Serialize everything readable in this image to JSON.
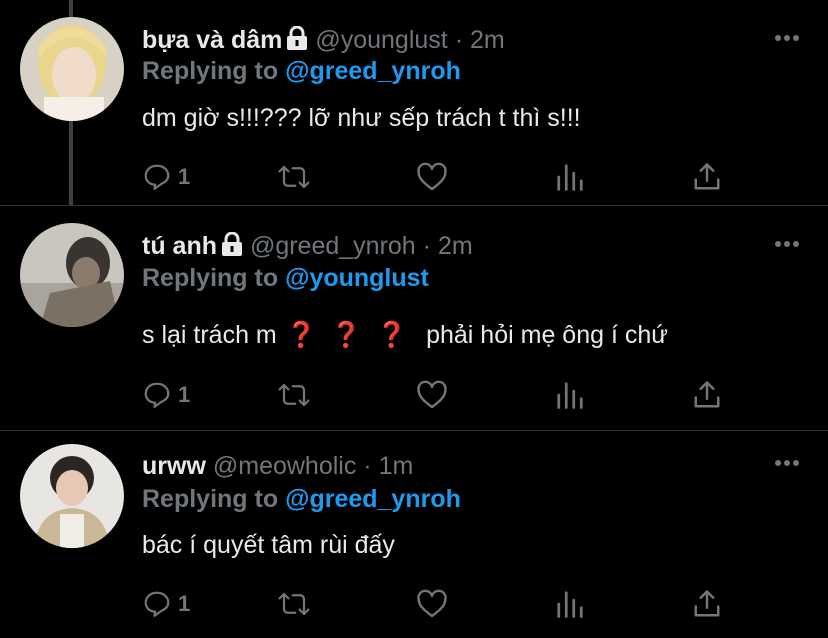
{
  "colors": {
    "background": "#000000",
    "accent": "#1d9bf0",
    "muted": "#71767b",
    "text": "#e7e9ea",
    "question_mark": "#e0245e"
  },
  "tweets": [
    {
      "name": "bựa và dâm",
      "protected": true,
      "handle": "@younglust",
      "separator": "·",
      "time": "2m",
      "replying_prefix": "Replying to",
      "replying_to": "@greed_ynroh",
      "text": "dm giờ s!!!??? lỡ như sếp trách t thì s!!!",
      "reply_count": "1",
      "icons": [
        "reply-icon",
        "retweet-icon",
        "like-icon",
        "analytics-icon",
        "share-icon",
        "more-icon",
        "lock-icon"
      ]
    },
    {
      "name": "tú anh",
      "protected": true,
      "handle": "@greed_ynroh",
      "separator": "·",
      "time": "2m",
      "replying_prefix": "Replying to",
      "replying_to": "@younglust",
      "text_before": "s lại trách m",
      "emoji": [
        "❓",
        "❓",
        "❓"
      ],
      "text_after": "phải hỏi mẹ ông í chứ",
      "reply_count": "1"
    },
    {
      "name": "urww",
      "protected": false,
      "handle": "@meowholic",
      "separator": "·",
      "time": "1m",
      "replying_prefix": "Replying to",
      "replying_to": "@greed_ynroh",
      "text": "bác í quyết tâm rùi đấy",
      "reply_count": "1"
    }
  ]
}
